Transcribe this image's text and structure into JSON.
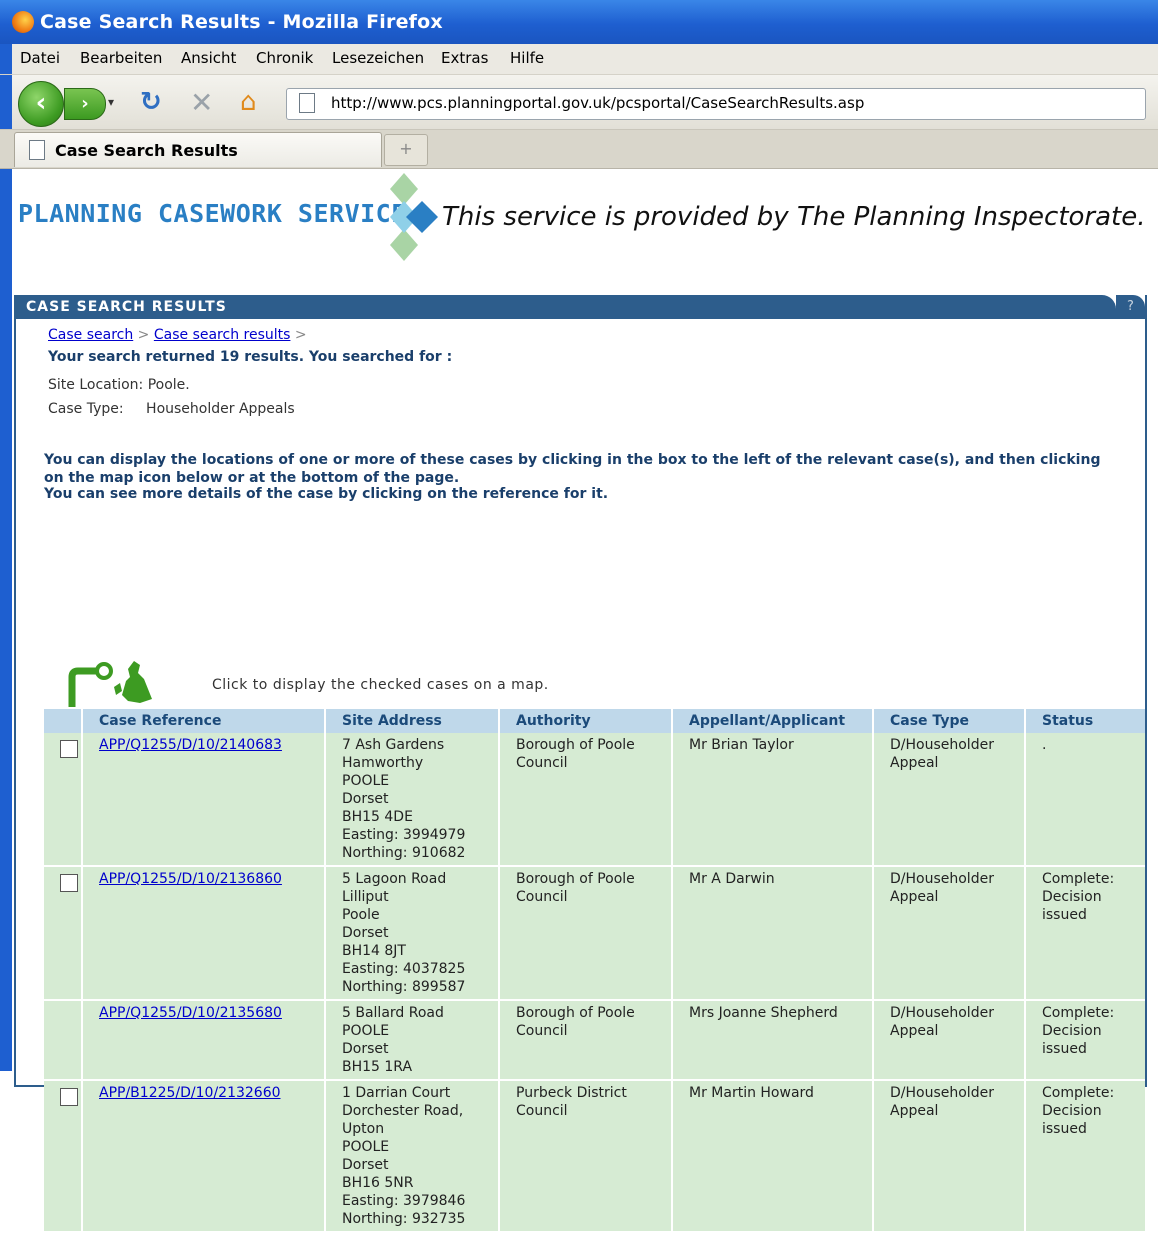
{
  "window": {
    "title": "Case Search Results - Mozilla Firefox"
  },
  "menu": [
    "Datei",
    "Bearbeiten",
    "Ansicht",
    "Chronik",
    "Lesezeichen",
    "Extras",
    "Hilfe"
  ],
  "url": "http://www.pcs.planningportal.gov.uk/pcsportal/CaseSearchResults.asp",
  "tab": {
    "label": "Case Search Results",
    "new_tab": "+"
  },
  "brand": {
    "name": "PLANNING CASEWORK SERVICE",
    "tagline": "This service is provided by The Planning Inspectorate."
  },
  "panel": {
    "header": "CASE SEARCH RESULTS",
    "help": "?"
  },
  "breadcrumb": {
    "item1": "Case search",
    "item2": "Case search results",
    "sep": ">"
  },
  "summary": "Your search returned 19 results. You searched for :",
  "criteria": {
    "site_location_label": "Site Location:",
    "site_location_value": "Poole.",
    "case_type_label": "Case Type:",
    "case_type_value": "Householder Appeals"
  },
  "instructions": {
    "line1": "You can display the locations of one or more of these cases by clicking in the box to the left of the relevant case(s), and then clicking on the map icon below or at the bottom of the page.",
    "line2": "You can see more details of the case by clicking on the reference for it."
  },
  "map_hint": "Click to display the checked cases on a map.",
  "table": {
    "headers": [
      "Case Reference",
      "Site Address",
      "Authority",
      "Appellant/Applicant",
      "Case Type",
      "Status"
    ],
    "rows": [
      {
        "checkbox": true,
        "ref": "APP/Q1255/D/10/2140683",
        "address": [
          "7 Ash Gardens",
          "Hamworthy",
          "POOLE",
          "Dorset",
          "BH15 4DE",
          "Easting: 3994979",
          "Northing: 910682"
        ],
        "authority": [
          "Borough of Poole",
          "Council"
        ],
        "appellant": "Mr Brian Taylor",
        "case_type": [
          "D/Householder",
          "Appeal"
        ],
        "status": [
          "."
        ]
      },
      {
        "checkbox": true,
        "ref": "APP/Q1255/D/10/2136860",
        "address": [
          "5 Lagoon Road",
          "Lilliput",
          "Poole",
          "Dorset",
          "BH14 8JT",
          "Easting: 4037825",
          "Northing: 899587"
        ],
        "authority": [
          "Borough of Poole",
          "Council"
        ],
        "appellant": "Mr A Darwin",
        "case_type": [
          "D/Householder",
          "Appeal"
        ],
        "status": [
          "Complete:",
          "Decision",
          "issued"
        ]
      },
      {
        "checkbox": false,
        "ref": "APP/Q1255/D/10/2135680",
        "address": [
          "5 Ballard Road",
          "POOLE",
          "Dorset",
          "BH15 1RA"
        ],
        "authority": [
          "Borough of Poole",
          "Council"
        ],
        "appellant": "Mrs Joanne Shepherd",
        "case_type": [
          "D/Householder",
          "Appeal"
        ],
        "status": [
          "Complete:",
          "Decision",
          "issued"
        ]
      },
      {
        "checkbox": true,
        "ref": "APP/B1225/D/10/2132660",
        "address": [
          "1 Darrian Court",
          "Dorchester Road,",
          "Upton",
          "POOLE",
          "Dorset",
          "BH16 5NR",
          "Easting: 3979846",
          "Northing: 932735"
        ],
        "authority": [
          "Purbeck District",
          "Council"
        ],
        "appellant": "Mr Martin Howard",
        "case_type": [
          "D/Householder",
          "Appeal"
        ],
        "status": [
          "Complete:",
          "Decision",
          "issued"
        ]
      }
    ]
  }
}
